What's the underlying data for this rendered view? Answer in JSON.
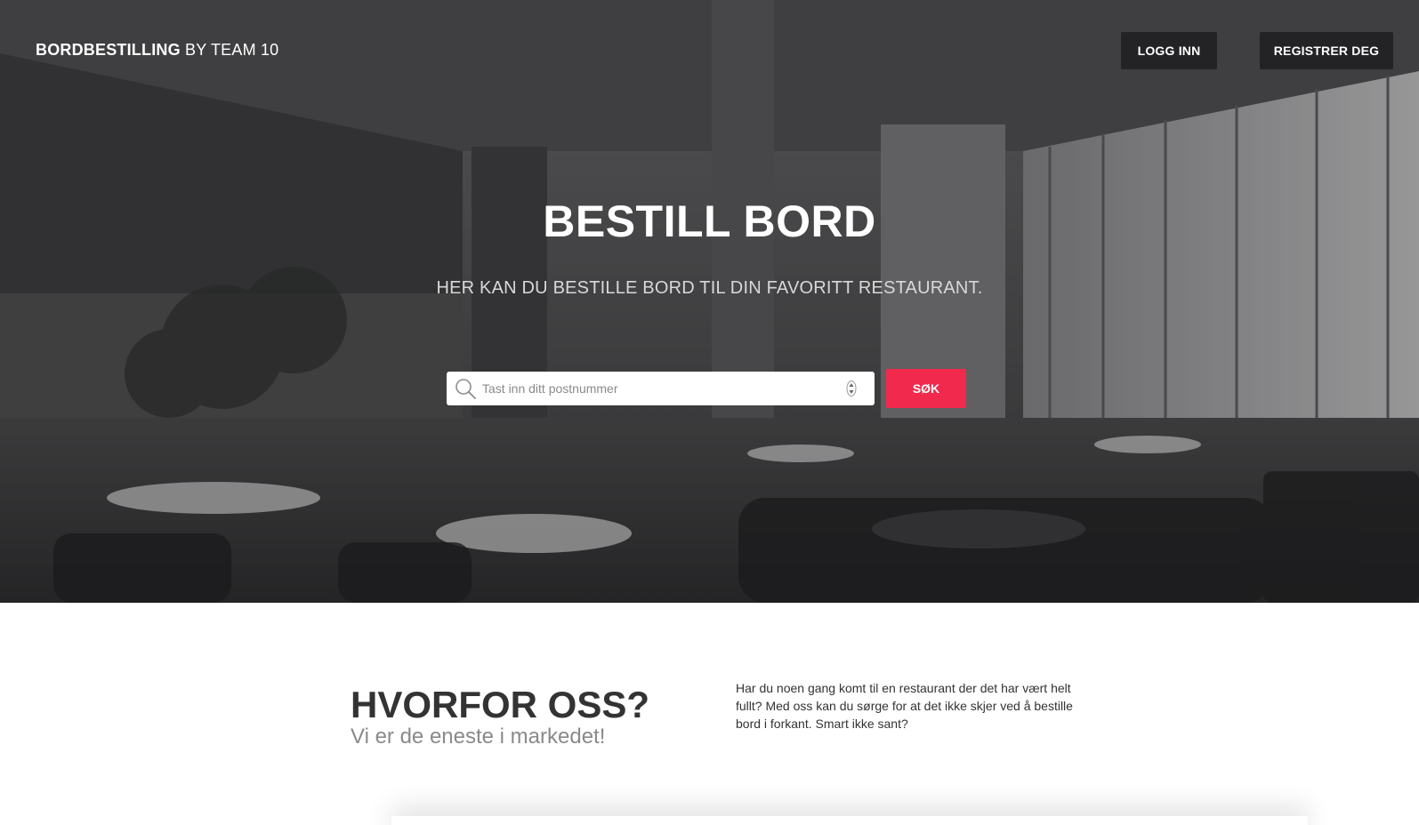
{
  "header": {
    "brand_strong": "BORDBESTILLING",
    "brand_light": " BY TEAM 10",
    "login_label": "LOGG INN",
    "register_label": "REGISTRER DEG"
  },
  "hero": {
    "title": "BESTILL BORD",
    "subtitle": "HER KAN DU BESTILLE BORD TIL DIN FAVORITT RESTAURANT.",
    "search_placeholder": "Tast inn ditt postnummer",
    "search_value": "",
    "search_button": "SØK"
  },
  "about": {
    "title": "HVORFOR OSS?",
    "subtitle": "Vi er de eneste i markedet!",
    "body": "Har du noen gang komt til en restaurant der det har vært helt fullt? Med oss kan du sørge for at det ikke skjer ved å bestille bord i forkant. Smart ikke sant?"
  },
  "colors": {
    "accent": "#f0294d",
    "nav_button_bg": "#232326",
    "heading": "#333333"
  },
  "icons": {
    "search": "search-icon",
    "spinner": "spinner-arrows-icon"
  }
}
